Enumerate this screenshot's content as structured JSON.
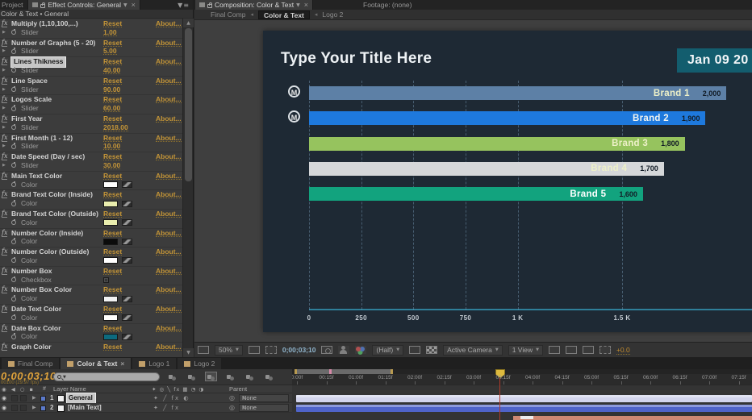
{
  "effect_controls": {
    "project_tab": "Project",
    "panel_tab": "Effect Controls: General",
    "context": "Color & Text • General",
    "reset_label": "Reset",
    "about_label": "About...",
    "properties": [
      {
        "name": "Multiply (1,10,100,...)",
        "type": "slider",
        "child_label": "Slider",
        "value": "1.00"
      },
      {
        "name": "Number of Graphs (5 - 20)",
        "type": "slider",
        "child_label": "Slider",
        "value": "5.00"
      },
      {
        "name": "Lines Thikness",
        "type": "slider",
        "child_label": "Slider",
        "value": "40.00",
        "selected": true
      },
      {
        "name": "Line Space",
        "type": "slider",
        "child_label": "Slider",
        "value": "90.00"
      },
      {
        "name": "Logos Scale",
        "type": "slider",
        "child_label": "Slider",
        "value": "60.00"
      },
      {
        "name": "First Year",
        "type": "slider",
        "child_label": "Slider",
        "value": "2018.00"
      },
      {
        "name": "First Month (1 - 12)",
        "type": "slider",
        "child_label": "Slider",
        "value": "10.00"
      },
      {
        "name": "Date Speed (Day / sec)",
        "type": "slider",
        "child_label": "Slider",
        "value": "30.00"
      },
      {
        "name": "Main Text Color",
        "type": "color",
        "child_label": "Color",
        "swatch": "#ffffff"
      },
      {
        "name": "Brand Text Color (Inside)",
        "type": "color",
        "child_label": "Color",
        "swatch": "#e9edae"
      },
      {
        "name": "Brand Text Color (Outside)",
        "type": "color",
        "child_label": "Color",
        "swatch": "#e9edae"
      },
      {
        "name": "Number Color (Inside)",
        "type": "color",
        "child_label": "Color",
        "swatch": "#0b0b0b"
      },
      {
        "name": "Number Color (Outside)",
        "type": "color",
        "child_label": "Color",
        "swatch": "#ffffff"
      },
      {
        "name": "Number Box",
        "type": "checkbox",
        "child_label": "Checkbox"
      },
      {
        "name": "Number Box Color",
        "type": "color",
        "child_label": "Color",
        "swatch": "#f2f2f2"
      },
      {
        "name": "Date Text Color",
        "type": "color",
        "child_label": "Color",
        "swatch": "#ffffff"
      },
      {
        "name": "Date Box Color",
        "type": "color",
        "child_label": "Color",
        "swatch": "#0d6a7e"
      },
      {
        "name": "Graph Color",
        "type": "header-only"
      }
    ]
  },
  "composition": {
    "tab": "Composition: Color & Text",
    "footage_tab": "Footage: (none)",
    "breadcrumb": [
      {
        "label": "Final Comp",
        "active": false
      },
      {
        "label": "Color & Text",
        "active": true
      },
      {
        "label": "Logo 2",
        "active": false
      }
    ],
    "title": "Type Your Title Here",
    "date_badge": "Jan 09 20",
    "date_badge_color": "#135d6e",
    "background_color": "#1e2934",
    "toolbar": {
      "zoom": "50%",
      "timecode": "0;00;03;10",
      "resolution": "(Half)",
      "camera": "Active Camera",
      "view": "1 View",
      "exposure": "+0.0"
    }
  },
  "chart_data": {
    "type": "bar",
    "orientation": "horizontal",
    "title": "Type Your Title Here",
    "categories": [
      "Brand 1",
      "Brand 2",
      "Brand 3",
      "Brand 4",
      "Brand 5"
    ],
    "values": [
      2000,
      1900,
      1800,
      1700,
      1600
    ],
    "value_labels": [
      "2,000",
      "1,900",
      "1,800",
      "1,700",
      "1,600"
    ],
    "bar_colors": [
      "#5d80a6",
      "#1e79dd",
      "#96c35e",
      "#d5d7d9",
      "#12a37e"
    ],
    "label_colors": [
      "#edf0c8",
      "#f2f4f0",
      "#edf0c8",
      "#edf0c8",
      "#ffffff"
    ],
    "value_color": "#121c26",
    "logo_letter": "M",
    "logos_visible": [
      true,
      true,
      false,
      false,
      false
    ],
    "x_ticks": [
      {
        "label": "0",
        "value": 0
      },
      {
        "label": "250",
        "value": 250
      },
      {
        "label": "500",
        "value": 500
      },
      {
        "label": "750",
        "value": 750
      },
      {
        "label": "1 K",
        "value": 1000
      },
      {
        "label": "1.5 K",
        "value": 1500
      }
    ],
    "xlim": [
      0,
      2125
    ],
    "grid": "dotted-vertical",
    "axis_color": "#2f7f99",
    "legend": "none"
  },
  "timeline": {
    "tabs": [
      {
        "label": "Final Comp",
        "active": false
      },
      {
        "label": "Color & Text",
        "active": true
      },
      {
        "label": "Logo 1",
        "active": false
      },
      {
        "label": "Logo 2",
        "active": false
      }
    ],
    "timecode": "0;00;03;10",
    "frame_info": "00100 (29.97 fps)",
    "search_placeholder": "",
    "columns": {
      "av_icons": "◉ ◀ ○ ▪",
      "number": "#",
      "layer_name": "Layer Name",
      "switches": "✦ ◎ ╲ fx ▦ ◔ ◑",
      "parent": "Parent"
    },
    "none_option": "None",
    "layers": [
      {
        "num": "1",
        "name": "General",
        "parent": "None",
        "selected": true,
        "switches": "✦ ╱ fx ◐",
        "bar_color": "#d2d4ec"
      },
      {
        "num": "2",
        "name": "[Main Text]",
        "parent": "None",
        "selected": false,
        "switches": "✦ ╱ fx",
        "bar_color": "#4f63c8"
      }
    ],
    "ruler_labels": [
      "0:00f",
      "00:15f",
      "01:00f",
      "01:15f",
      "02:00f",
      "02:15f",
      "03:00f",
      "03:15f",
      "04:00f",
      "04:15f",
      "05:00f",
      "05:15f",
      "06:00f",
      "06:15f",
      "07:00f",
      "07:15f"
    ]
  }
}
